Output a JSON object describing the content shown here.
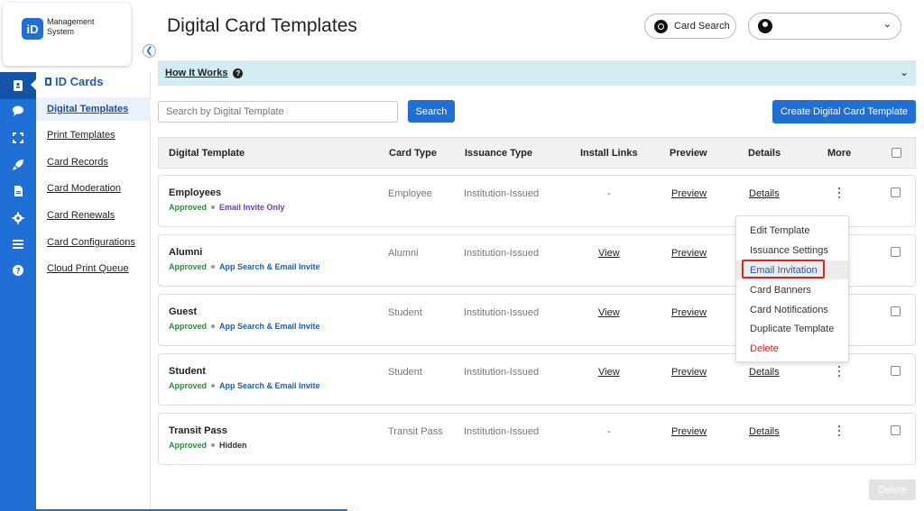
{
  "logo": {
    "badge": "iD",
    "line1": "Management",
    "line2": "System"
  },
  "rail": {
    "icons": [
      "id-card-icon",
      "chat-icon",
      "scan-icon",
      "rocket-icon",
      "document-icon",
      "gear-icon",
      "list-icon",
      "help-icon"
    ]
  },
  "subnav": {
    "title": "ID Cards",
    "items": [
      {
        "label": "Digital Templates",
        "active": true
      },
      {
        "label": "Print Templates"
      },
      {
        "label": "Card Records"
      },
      {
        "label": "Card Moderation"
      },
      {
        "label": "Card Renewals"
      },
      {
        "label": "Card Configurations"
      },
      {
        "label": "Cloud Print Queue"
      }
    ]
  },
  "header": {
    "title": "Digital Card Templates",
    "card_search": "Card Search"
  },
  "how": {
    "label": "How It Works",
    "q": "?"
  },
  "search": {
    "placeholder": "Search by Digital Template",
    "button": "Search"
  },
  "create_button": "Create Digital Card Template",
  "table": {
    "headers": [
      "Digital Template",
      "Card Type",
      "Issuance Type",
      "Install Links",
      "Preview",
      "Details",
      "More"
    ],
    "rows": [
      {
        "name": "Employees",
        "status": "Approved",
        "mode": "Email Invite Only",
        "card_type": "Employee",
        "issuance": "Institution-Issued",
        "install": "-",
        "preview": "Preview",
        "details": "Details"
      },
      {
        "name": "Alumni",
        "status": "Approved",
        "mode": "App Search & Email Invite",
        "card_type": "Alumni",
        "issuance": "Institution-Issued",
        "install": "View",
        "preview": "Preview",
        "details": ""
      },
      {
        "name": "Guest",
        "status": "Approved",
        "mode": "App Search & Email Invite",
        "card_type": "Student",
        "issuance": "Institution-Issued",
        "install": "View",
        "preview": "Preview",
        "details": ""
      },
      {
        "name": "Student",
        "status": "Approved",
        "mode": "App Search & Email Invite",
        "card_type": "Student",
        "issuance": "Institution-Issued",
        "install": "View",
        "preview": "Preview",
        "details": "Details"
      },
      {
        "name": "Transit Pass",
        "status": "Approved",
        "mode": "Hidden",
        "card_type": "Transit Pass",
        "issuance": "Institution-Issued",
        "install": "-",
        "preview": "Preview",
        "details": "Details"
      }
    ]
  },
  "menu": {
    "items": [
      "Edit Template",
      "Issuance Settings",
      "Email Invitation",
      "Card Banners",
      "Card Notifications",
      "Duplicate Template",
      "Delete"
    ],
    "highlighted": "Email Invitation"
  },
  "delete_button": "Delete",
  "colors": {
    "accent": "#1f6fd6",
    "approved": "#2e8b3a",
    "danger": "#e02020",
    "highlight_border": "#e32222"
  }
}
